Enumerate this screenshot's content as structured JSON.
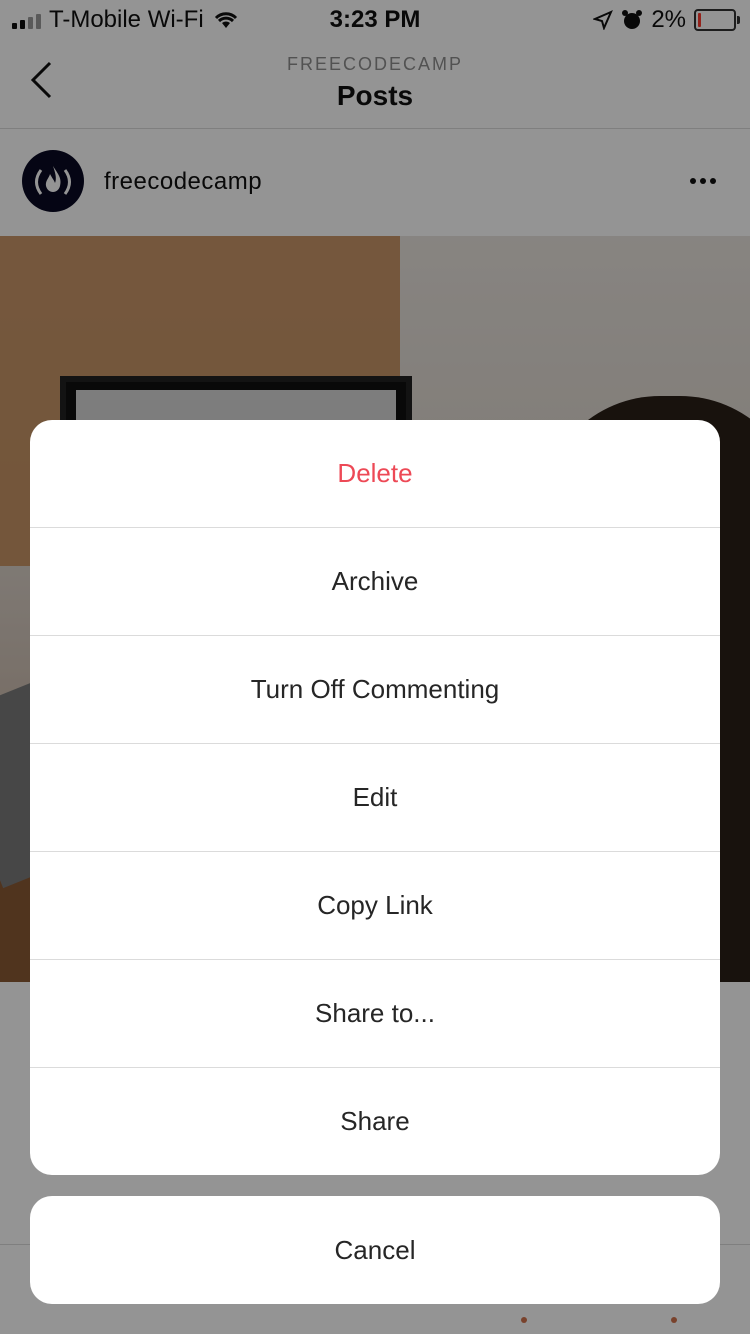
{
  "status_bar": {
    "carrier": "T-Mobile Wi-Fi",
    "time": "3:23 PM",
    "battery": "2%"
  },
  "header": {
    "account": "FREECODECAMP",
    "title": "Posts"
  },
  "post": {
    "username": "freecodecamp"
  },
  "action_sheet": {
    "items": [
      {
        "label": "Delete",
        "style": "destructive"
      },
      {
        "label": "Archive"
      },
      {
        "label": "Turn Off Commenting"
      },
      {
        "label": "Edit"
      },
      {
        "label": "Copy Link"
      },
      {
        "label": "Share to..."
      },
      {
        "label": "Share"
      }
    ],
    "cancel_label": "Cancel"
  },
  "colors": {
    "destructive": "#ed4956",
    "text": "#262626",
    "accent_dot": "#d0734d"
  }
}
